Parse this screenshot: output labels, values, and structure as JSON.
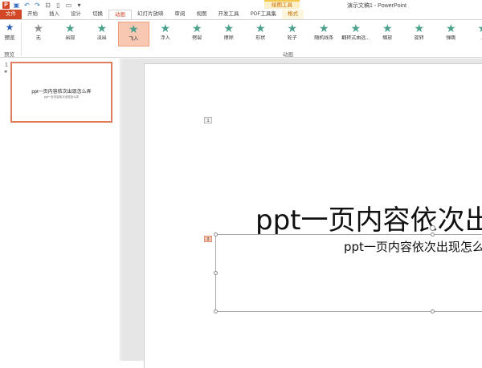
{
  "window": {
    "title": "演示文稿1 - PowerPoint",
    "context_tab_group": "绘图工具"
  },
  "qat": [
    {
      "name": "powerpoint-logo",
      "glyph": "P"
    },
    {
      "name": "save-icon",
      "glyph": "▣"
    },
    {
      "name": "undo-icon",
      "glyph": "↶"
    },
    {
      "name": "redo-icon",
      "glyph": "↷"
    },
    {
      "name": "start-from-beginning-icon",
      "glyph": "⊡"
    },
    {
      "name": "new-file-icon",
      "glyph": "▯"
    },
    {
      "name": "open-file-icon",
      "glyph": "▭"
    },
    {
      "name": "qat-dropdown-icon",
      "glyph": "▾"
    }
  ],
  "tabs": [
    {
      "label": "文件",
      "kind": "file"
    },
    {
      "label": "开始"
    },
    {
      "label": "插入"
    },
    {
      "label": "设计"
    },
    {
      "label": "切换"
    },
    {
      "label": "动画",
      "active": true
    },
    {
      "label": "幻灯片放映"
    },
    {
      "label": "审阅"
    },
    {
      "label": "视图"
    },
    {
      "label": "开发工具"
    },
    {
      "label": "PDF工具集"
    },
    {
      "label": "格式",
      "kind": "ctx"
    }
  ],
  "ribbon": {
    "preview_label": "预览",
    "preview_group_label": "预览",
    "animation_group_label": "动画",
    "animations": [
      {
        "label": "无",
        "icon": "none"
      },
      {
        "label": "出现"
      },
      {
        "label": "淡出"
      },
      {
        "label": "飞入",
        "selected": true
      },
      {
        "label": "浮入"
      },
      {
        "label": "劈裂"
      },
      {
        "label": "擦除"
      },
      {
        "label": "形状"
      },
      {
        "label": "轮子"
      },
      {
        "label": "随机线条"
      },
      {
        "label": "翻转式由远..."
      },
      {
        "label": "缩放"
      },
      {
        "label": "旋转"
      },
      {
        "label": "弹跳"
      },
      {
        "label": "..."
      }
    ]
  },
  "thumbnail": {
    "number": "1",
    "animation_marker": "✱",
    "title": "ppt一页内容依次出现怎么弄",
    "subtitle": "ppt一页内容依次出现怎么弄"
  },
  "slide": {
    "title": "ppt一页内容依次出现怎么弄",
    "subtitle": "ppt一页内容依次出现怎么弄",
    "anim_tags": [
      "1",
      "2"
    ]
  }
}
